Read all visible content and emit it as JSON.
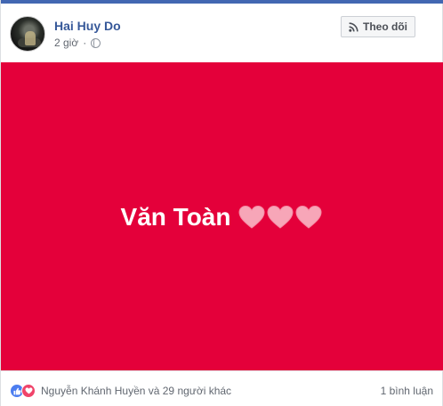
{
  "post": {
    "author_name": "Hai Huy Do",
    "timestamp": "2 giờ",
    "separator": "·",
    "privacy_icon": "globe-icon",
    "follow_label": "Theo dõi",
    "follow_icon": "rss-icon"
  },
  "banner": {
    "background_color": "#e4003a",
    "text": "Văn Toàn",
    "hearts": [
      "heart-icon",
      "heart-icon",
      "heart-icon"
    ],
    "heart_color": "#f7a6b8"
  },
  "footer": {
    "reaction_icons": [
      "like-icon",
      "love-icon"
    ],
    "reactors_text": "Nguyễn Khánh Huyền và 29 người khác",
    "comments_text": "1 bình luận"
  },
  "colors": {
    "accent": "#4267b2",
    "name_link": "#365899",
    "meta_text": "#616770"
  }
}
